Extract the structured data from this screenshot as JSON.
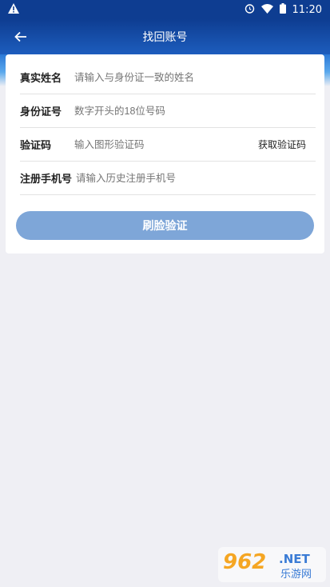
{
  "status_bar": {
    "warning_icon": "warning-triangle-icon",
    "alarm_icon": "alarm-clock-icon",
    "wifi_icon": "wifi-icon",
    "battery_icon": "battery-icon",
    "time": "11:20"
  },
  "header": {
    "back_icon": "back-arrow-icon",
    "title": "找回账号"
  },
  "form": {
    "fields": [
      {
        "label": "真实姓名",
        "placeholder": "请输入与身份证一致的姓名"
      },
      {
        "label": "身份证号",
        "placeholder": "数字开头的18位号码"
      },
      {
        "label": "验证码",
        "placeholder": "输入图形验证码",
        "action": "获取验证码"
      },
      {
        "label": "注册手机号",
        "placeholder": "请输入历史注册手机号"
      }
    ],
    "submit_label": "刷脸验证"
  },
  "watermark": {
    "logo_text": "962",
    "suffix": ".NET",
    "caption": "乐游网"
  },
  "colors": {
    "header_dark": "#0e3d91",
    "header_light": "#1d5dbd",
    "button": "#7ea6d8",
    "background": "#efeff4"
  }
}
